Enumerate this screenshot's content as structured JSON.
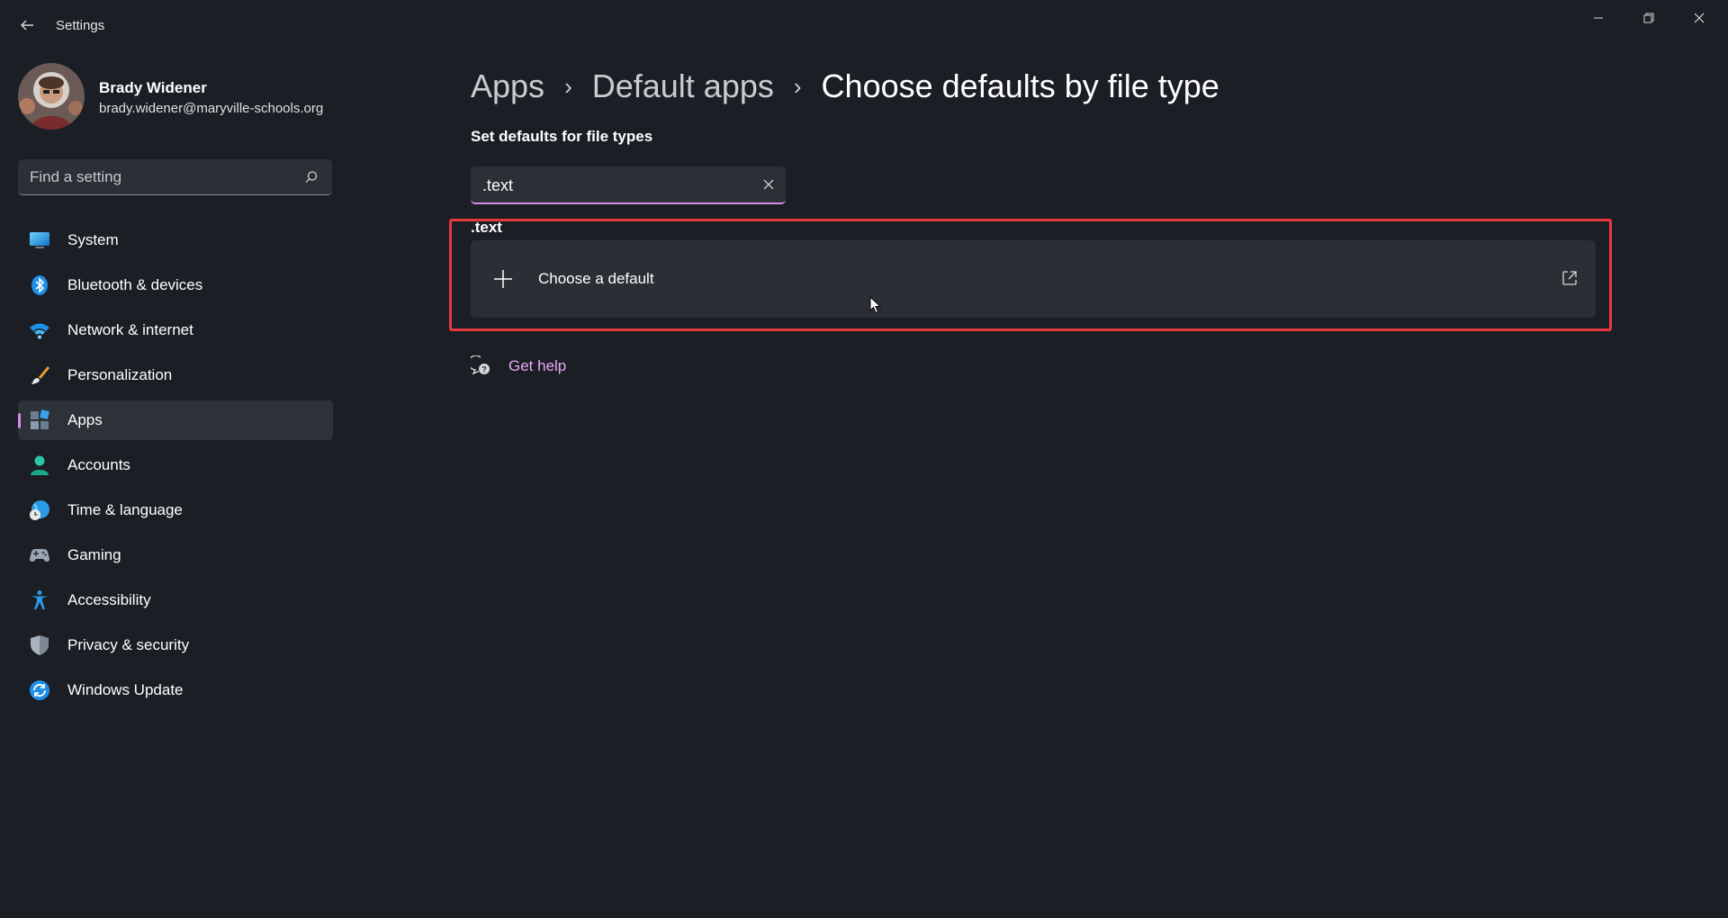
{
  "window": {
    "title": "Settings",
    "minimize_glyph": "—",
    "maximize_glyph": "❐",
    "close_glyph": "✕"
  },
  "profile": {
    "name": "Brady Widener",
    "email": "brady.widener@maryville-schools.org"
  },
  "search": {
    "placeholder": "Find a setting"
  },
  "sidebar": {
    "items": [
      {
        "label": "System",
        "icon": "monitor-icon"
      },
      {
        "label": "Bluetooth & devices",
        "icon": "bluetooth-icon"
      },
      {
        "label": "Network & internet",
        "icon": "wifi-icon"
      },
      {
        "label": "Personalization",
        "icon": "brush-icon"
      },
      {
        "label": "Apps",
        "icon": "apps-icon",
        "active": true
      },
      {
        "label": "Accounts",
        "icon": "person-icon"
      },
      {
        "label": "Time & language",
        "icon": "globe-clock-icon"
      },
      {
        "label": "Gaming",
        "icon": "gamepad-icon"
      },
      {
        "label": "Accessibility",
        "icon": "accessibility-icon"
      },
      {
        "label": "Privacy & security",
        "icon": "shield-icon"
      },
      {
        "label": "Windows Update",
        "icon": "sync-icon"
      }
    ]
  },
  "breadcrumb": {
    "items": [
      "Apps",
      "Default apps"
    ],
    "separator": "›",
    "current": "Choose defaults by file type"
  },
  "main": {
    "section_title": "Set defaults for file types",
    "file_type_search_value": ".text",
    "extension_label": ".text",
    "choose_default_label": "Choose a default",
    "help_label": "Get help"
  },
  "colors": {
    "accent": "#d78cea",
    "highlight_border": "#e5383f",
    "link": "#e8a8f6",
    "background": "#1b1f25"
  }
}
